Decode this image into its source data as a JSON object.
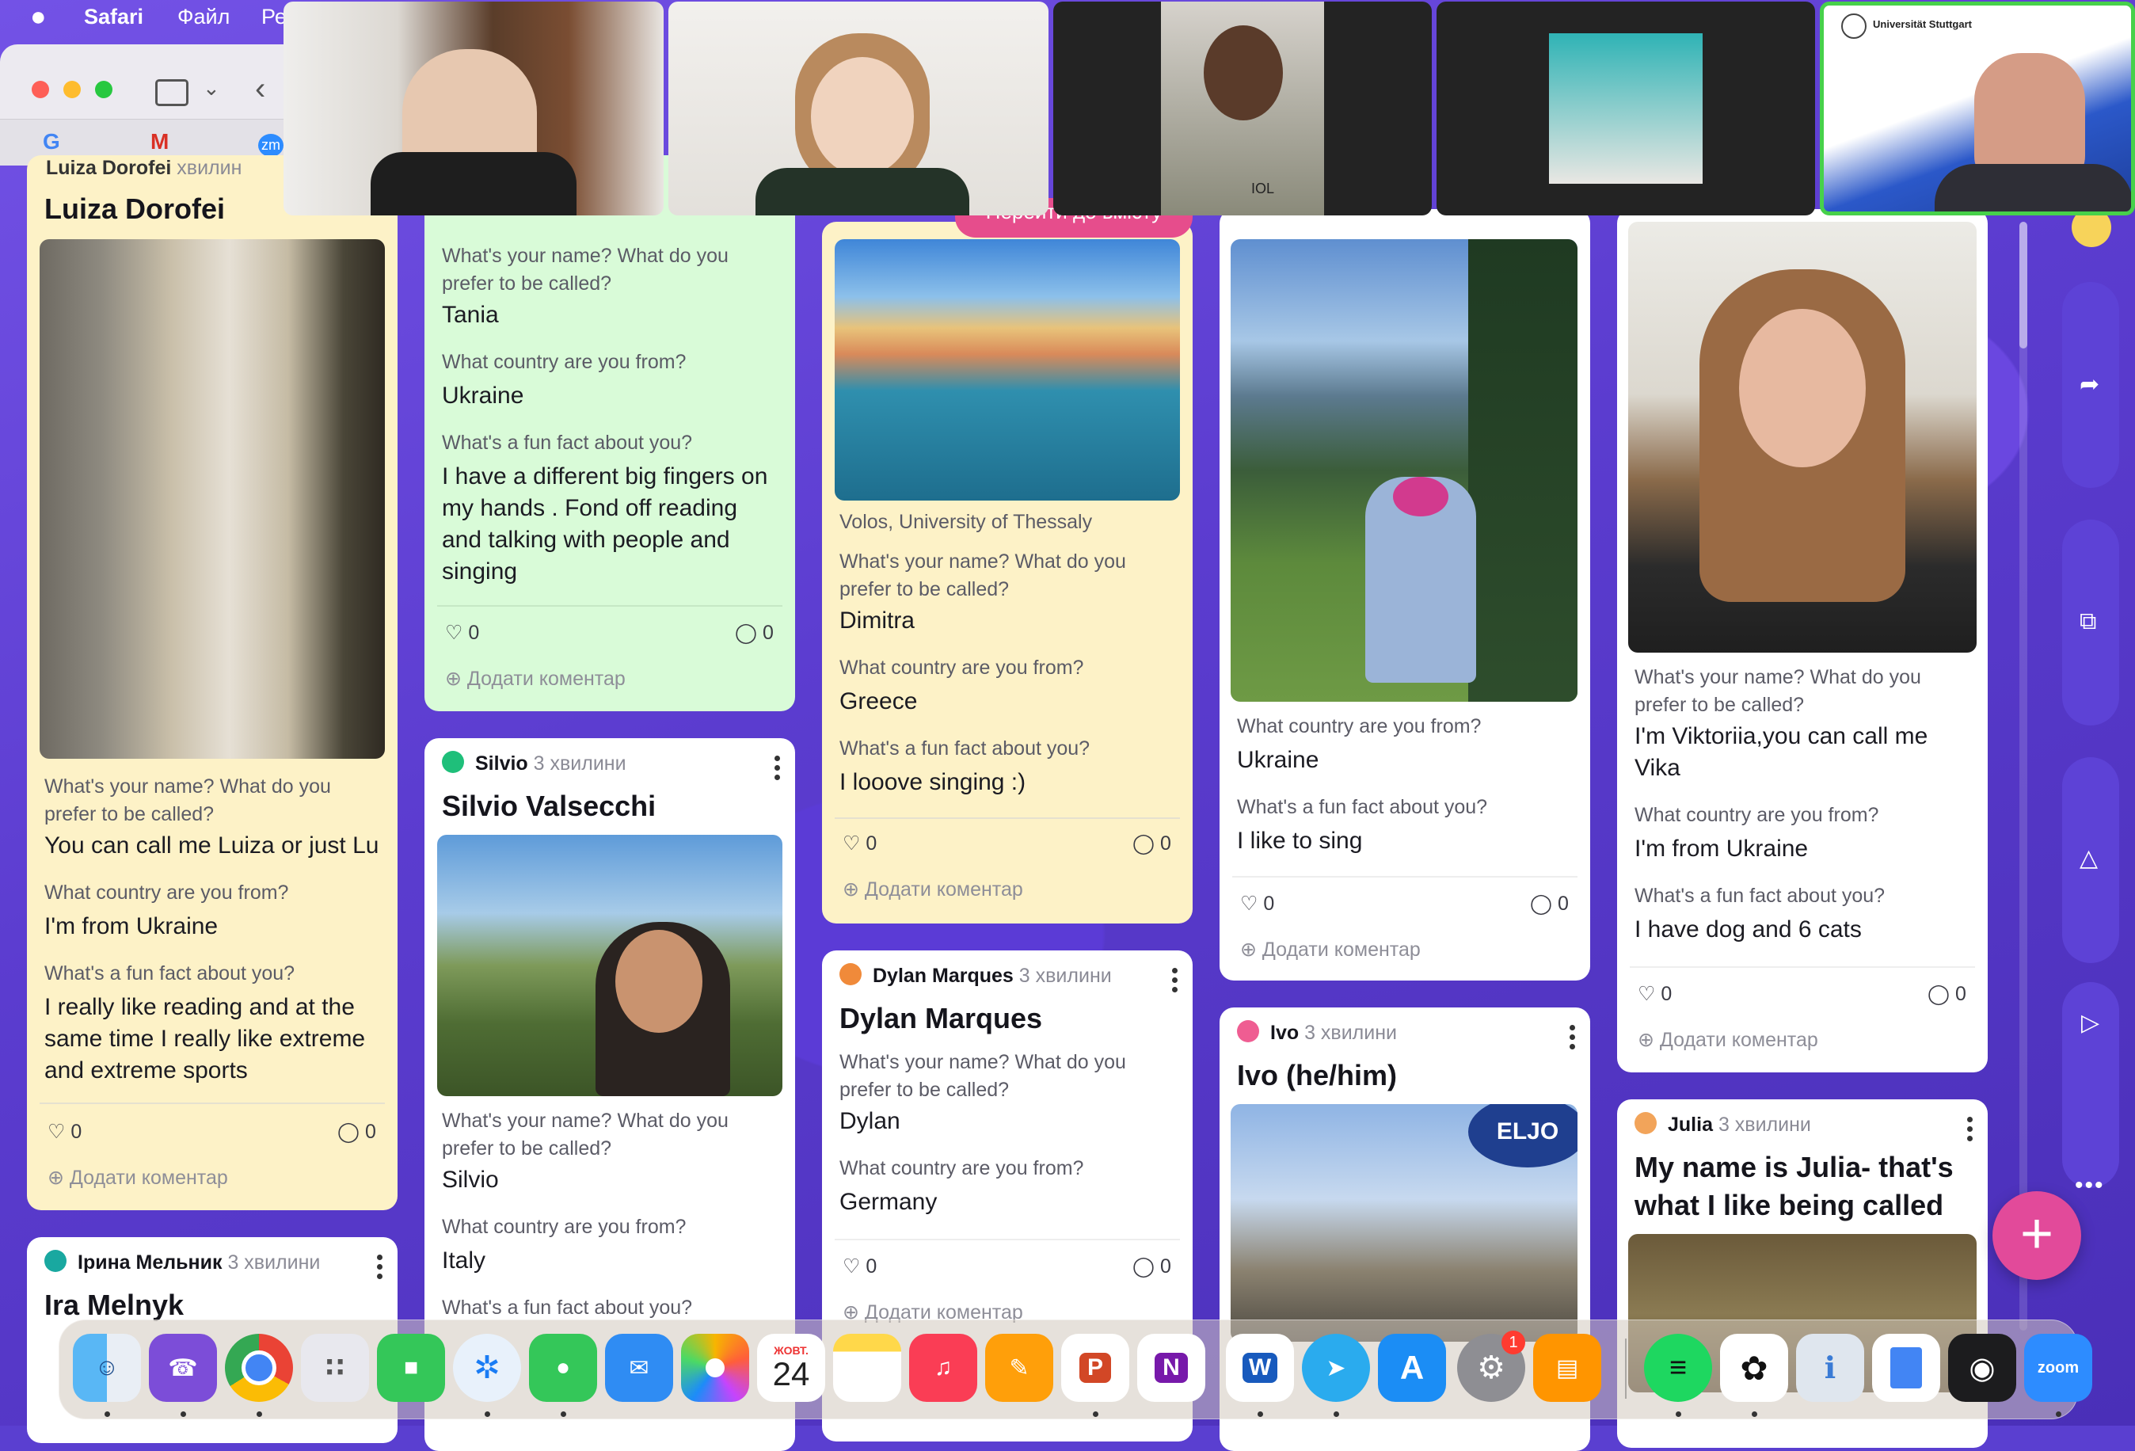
{
  "menubar": {
    "apple": "",
    "app": "Safari",
    "file_menu": "Файл",
    "next_menu": "Ре"
  },
  "safari": {
    "tab_favicons": [
      "G",
      "M",
      "zm"
    ]
  },
  "board": {
    "follow_button": "Перейти до вмісту",
    "comment_label": "Додати коментар",
    "columns": [
      {
        "cards": [
          {
            "author_partial": "Luiza Dorofei",
            "time_partial": "хвилин",
            "title": "Luiza Dorofei",
            "q1": "What's your name?  What do you prefer to be called?",
            "a1": "You can call me Luiza or just Lu",
            "q2": "What country are you from?",
            "a2": "I'm from Ukraine",
            "q3": "What's a fun fact about you?",
            "a3": "I really like reading and at the same time I really like extreme and extreme sports",
            "likes": "0",
            "comments": "0"
          },
          {
            "author": "Ірина Мельник",
            "time": "3 хвилини",
            "title": "Ira Melnyk"
          }
        ]
      },
      {
        "cards": [
          {
            "q1": "What's your name?  What do you prefer to be called?",
            "a1": "Tania",
            "q2": "What country are you from?",
            "a2": "Ukraine",
            "q3": "What's a fun fact about you?",
            "a3": "I have a different big fingers on my hands . Fond off reading and talking with people and singing",
            "likes": "0",
            "comments": "0"
          },
          {
            "author": "Silvio",
            "time": "3 хвилини",
            "title": "Silvio Valsecchi",
            "q1": "What's your name?  What do you prefer to be called?",
            "a1": "Silvio",
            "q2": "What country are you from?",
            "a2": "Italy",
            "q3": "What's a fun fact about you?"
          }
        ]
      },
      {
        "cards": [
          {
            "caption": "Volos, University of Thessaly",
            "q1": "What's your name?  What do you prefer to be called?",
            "a1": "Dimitra",
            "q2": "What country are you from?",
            "a2": "Greece",
            "q3": "What's a fun fact about you?",
            "a3": "I looove singing :)",
            "likes": "0",
            "comments": "0"
          },
          {
            "author": "Dylan Marques",
            "time": "3 хвилини",
            "title": "Dylan Marques",
            "q1": "What's your name?  What do you prefer to be called?",
            "a1": "Dylan",
            "q2": "What country are you from?",
            "a2": "Germany",
            "likes": "0",
            "comments": "0"
          }
        ]
      },
      {
        "cards": [
          {
            "q2": "What country are you from?",
            "a2": "Ukraine",
            "q3": "What's a fun fact about you?",
            "a3": "I like to sing",
            "likes": "0",
            "comments": "0"
          },
          {
            "author": "Ivo",
            "time": "3 хвилини",
            "title": "Ivo (he/him)",
            "sign_text": "ELJO"
          }
        ]
      },
      {
        "cards": [
          {
            "q1": "What's your name?  What do you prefer to be called?",
            "a1": "I'm Viktoriia,you can call me Vika",
            "q2": "What country are you from?",
            "a2": "I'm from Ukraine",
            "q3": "What's a fun fact about you?",
            "a3": "I have dog and 6 cats",
            "likes": "0",
            "comments": "0"
          },
          {
            "author": "Julia",
            "time": "3 хвилини",
            "title": "My name is Julia- that's what I like being called"
          }
        ]
      }
    ]
  },
  "video_strip": {
    "host_label": "Universität Stuttgart",
    "badge": "IOL"
  },
  "rail": {
    "more": "•••",
    "add": "+"
  },
  "dock": {
    "calendar_month": "ЖОВТ.",
    "calendar_day": "24",
    "settings_badge": "1",
    "zoom_label": "zoom",
    "apps": [
      "Finder",
      "Viber",
      "Chrome",
      "Launchpad",
      "FaceTime",
      "Safari",
      "Messages",
      "Mail",
      "Photos",
      "Calendar",
      "Notes",
      "Music",
      "Pages",
      "PowerPoint",
      "OneNote",
      "Word",
      "Telegram",
      "App Store",
      "System Settings",
      "Books",
      "Spotify",
      "ChatGPT",
      "Preview",
      "Docs",
      "Screenshot",
      "Zoom"
    ]
  },
  "colors": {
    "board": "#5b3ccf",
    "yellow_card": "#fdf2c7",
    "green_card": "#d9fbd8",
    "add_button": "#e24a9a",
    "active_speaker": "#47d14a"
  }
}
